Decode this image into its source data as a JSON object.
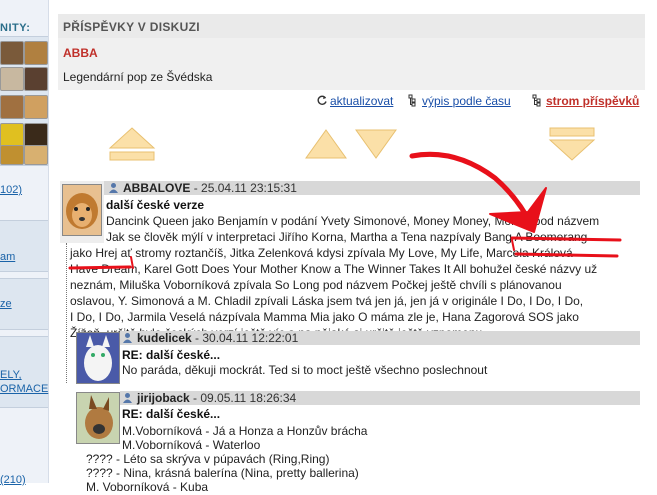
{
  "sidebar": {
    "title": "NITY:",
    "links": [
      "102)",
      "am",
      "ze",
      "ELY,",
      "ORMACE",
      "(210)"
    ]
  },
  "header": {
    "title": "PŘÍSPĚVKY V DISKUZI"
  },
  "topic": {
    "title": "ABBA",
    "description": "Legendární pop ze Švédska"
  },
  "toolbar": {
    "refresh": "aktualizovat",
    "by_time": "výpis podle času",
    "tree": "strom příspěvků"
  },
  "posts": [
    {
      "author": "ABBALOVE",
      "date": "- 25.04.11 23:15:31",
      "title": "další české verze",
      "lines": [
        "Dancink Queen jako Benjamín v podání Yvety Simonové, Money Money, Money pod názvem",
        "Jak se člověk mýlí v interpretaci Jiřího Korna, Martha a Tena nazpívaly Bang A Boomerang",
        "jako Hrej ať stromy roztančíš, Jitka Zelenková kdysi zpívala My Love, My Life, Marcela Králová",
        "Have Dream, Karel Gott Does Your Mother Know a The Winner Takes It All bohužel české názvy už",
        "neznám, Miluška Voborníková zpívala So Long pod názvem Počkej ještě chvíli s plánovanou",
        "oslavou, Y. Simonová a M. Chladil zpívali Láska jsem tvá jen já, jen já v originále I Do, I Do, I Do,",
        "I Do, I Do, Jarmila Veselá názpívala Mamma Mia jako O máma zle je, Hana Zagorová SOS jako",
        "Žížeň, určitě bylo českých verzí ještě víc a na nějaké si určitě ještě vzpomenu"
      ]
    },
    {
      "author": "kudelicek",
      "date": "- 30.04.11 12:22:01",
      "title": "RE: další české...",
      "lines": [
        "No paráda, děkuji mockrát. Ted si to moct ještě všechno poslechnout"
      ]
    },
    {
      "author": "jirijoback",
      "date": "- 09.05.11 18:26:34",
      "title": "RE: další české...",
      "lines": [
        "M.Voborníková - Já a Honza a Honzův brácha",
        "M.Voborníková - Waterloo",
        "???? - Léto sa skrýva v púpavách (Ring,Ring)",
        "???? - Nina, krásná balerína (Nina, pretty ballerina)",
        "M. Voborníková - Kuba"
      ]
    }
  ],
  "colors": {
    "link": "#1a4fa8",
    "accent_red": "#c0302a",
    "annotation_red": "#e8101a",
    "arrow_fill": "#fbe0a8",
    "arrow_stroke": "#e8c070"
  }
}
